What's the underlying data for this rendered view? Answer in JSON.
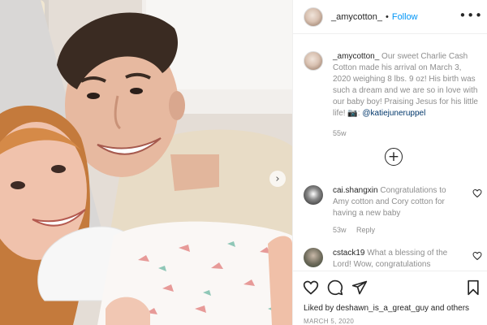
{
  "post": {
    "username": "_amycotton_",
    "follow_label": "Follow",
    "separator": "•",
    "more_glyph": "•••"
  },
  "caption": {
    "username": "_amycotton_",
    "text": "Our sweet Charlie Cash Cotton made his arrival on March 3, 2020 weighing 8 lbs. 9 oz! His birth was such a dream and we are so in love with our baby boy! Praising Jesus for his little life! 📷:",
    "mention": "@katiejuneruppel",
    "time": "55w"
  },
  "comments": [
    {
      "username": "cai.shangxin",
      "text": "Congratulations to Amy cotton and Cory cotton for having a new baby",
      "time": "53w",
      "reply_label": "Reply"
    },
    {
      "username": "cstack19",
      "text": "What a blessing of the Lord! Wow, congratulations"
    }
  ],
  "load_more_glyph": "+",
  "photo_nav_glyph": "›",
  "likes": {
    "prefix": "Liked by",
    "user": "deshawn_is_a_great_guy",
    "connector": "and",
    "suffix": "others"
  },
  "date": "MARCH 5, 2020",
  "colors": {
    "follow_blue": "#0095f6",
    "mention_blue": "#00376b",
    "secondary_text": "#8e8e8e",
    "primary_text": "#262626",
    "divider": "#efefef"
  },
  "icons": [
    "heart-icon",
    "comment-icon",
    "share-icon",
    "bookmark-icon",
    "more-icon",
    "add-circle-icon",
    "chevron-right-icon"
  ]
}
